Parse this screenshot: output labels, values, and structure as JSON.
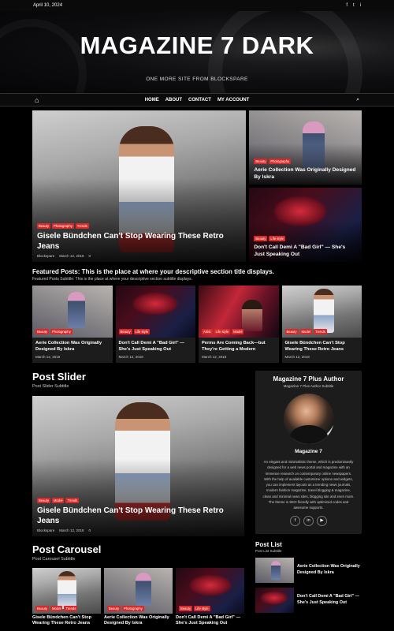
{
  "topbar": {
    "date": "April 10, 2024",
    "socials": [
      "f",
      "t",
      "i"
    ]
  },
  "site": {
    "title": "MAGAZINE 7 DARK",
    "tagline": "ONE MORE SITE FROM BLOCKSPARE"
  },
  "nav": {
    "items": [
      "HOME",
      "ABOUT",
      "CONTACT",
      "MY ACCOUNT"
    ]
  },
  "featured_main": {
    "tags": [
      "Beauty",
      "Photography",
      "Trends"
    ],
    "title": "Gisele Bündchen Can't Stop Wearing These Retro Jeans",
    "author": "Blockspare",
    "date": "March 12, 2018",
    "comments": "0"
  },
  "side_posts": [
    {
      "tags": [
        "Beauty",
        "Photography"
      ],
      "title": "Aerie Collection Was Originally Designed By Iskra"
    },
    {
      "tags": [
        "Beauty",
        "Life style"
      ],
      "title": "Don't Call Demi A \"Bad Girl\" — She's Just Speaking Out"
    }
  ],
  "featured_section": {
    "title": "Featured Posts: This is the place at where your descriptive section title displays.",
    "subtitle": "Featured Posts Subtitle: This is the place at where your descriptive section subtitle displays."
  },
  "featured_cards": [
    {
      "tags": [
        "Beauty",
        "Photography"
      ],
      "title": "Aerie Collection Was Originally Designed By Iskra",
      "date": "March 12, 2018"
    },
    {
      "tags": [
        "Beauty",
        "Life style"
      ],
      "title": "Don't Call Demi A \"Bad Girl\" — She's Just Speaking Out",
      "date": "March 12, 2018"
    },
    {
      "tags": [
        "Artist",
        "Life style",
        "Model"
      ],
      "title": "Perms Are Coming Back—but They're Getting a Modern",
      "date": "March 12, 2018"
    },
    {
      "tags": [
        "Beauty",
        "Model",
        "Trends"
      ],
      "title": "Gisele Bündchen Can't Stop Wearing These Retro Jeans",
      "date": "March 12, 2018"
    }
  ],
  "slider": {
    "title": "Post Slider",
    "subtitle": "Post Slider Subtitle",
    "tags": [
      "Beauty",
      "Model",
      "Trends"
    ],
    "post_title": "Gisele Bündchen Can't Stop Wearing These Retro Jeans",
    "author": "Blockspare",
    "date": "March 12, 2018",
    "comments": "0"
  },
  "carousel": {
    "title": "Post Carousel",
    "subtitle": "Post Carousel Subtitle",
    "items": [
      {
        "tags": [
          "Beauty",
          "Model",
          "Trends"
        ],
        "title": "Gisele Bündchen Can't Stop Wearing These Retro Jeans"
      },
      {
        "tags": [
          "Beauty",
          "Photography"
        ],
        "title": "Aerie Collection Was Originally Designed By Iskra"
      },
      {
        "tags": [
          "Beauty",
          "Life style"
        ],
        "title": "Don't Call Demi A \"Bad Girl\" — She's Just Speaking Out"
      }
    ]
  },
  "author": {
    "title": "Magazine 7 Plus Author",
    "subtitle": "Magazine 7 Plus Author Subtitle",
    "name": "Magazine 7",
    "bio": "An elegant and minimalistic theme, which is predominantly designed for a web news portal and magazine with an immense research on contemporary online newspapers. With the help of available customizer options and widgets, you can implement layouts as a trending news journals, modern fashion magazine, travel blogging & magazine, clean and minimal news sites, blogging site and even more. The theme is SEO friendly with optimized codes and awesome supports.",
    "socials": [
      "f",
      "in",
      "▶"
    ]
  },
  "post_list": {
    "title": "Post List",
    "subtitle": "Post List Subtitle",
    "items": [
      {
        "title": "Aerie Collection Was Originally Designed By Iskra"
      },
      {
        "title": "Don't Call Demi A \"Bad Girl\" — She's Just Speaking Out"
      }
    ]
  }
}
